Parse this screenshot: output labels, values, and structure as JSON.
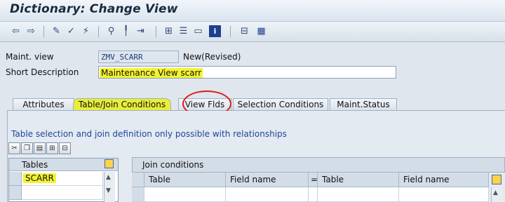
{
  "window": {
    "title": "Dictionary: Change View"
  },
  "toolbar": {
    "icons": [
      "back-icon",
      "forward-icon",
      "display-change-icon",
      "check-icon",
      "activate-icon",
      "where-used-icon",
      "object-list-icon",
      "navigate-icon",
      "hierarchy-icon",
      "print-icon",
      "display-icon",
      "info-icon",
      "technical-settings-icon",
      "grid-icon"
    ]
  },
  "form": {
    "maint_view_label": "Maint. view",
    "maint_view_value": "ZMV_SCARR",
    "status": "New(Revised)",
    "short_desc_label": "Short Description",
    "short_desc_value": "Maintenance View scarr"
  },
  "tabs": [
    {
      "label": "Attributes"
    },
    {
      "label": "Table/Join Conditions"
    },
    {
      "label": "View Flds"
    },
    {
      "label": "Selection Conditions"
    },
    {
      "label": "Maint.Status"
    }
  ],
  "panel": {
    "info": "Table selection and join definition only possible with relationships"
  },
  "tables_grid": {
    "header": "Tables",
    "rows": [
      "SCARR",
      "",
      ""
    ]
  },
  "join_grid": {
    "title": "Join conditions",
    "columns": [
      "Table",
      "Field name",
      "=",
      "Table",
      "Field name"
    ]
  },
  "colors": {
    "highlight": "#f3f332",
    "annotation": "#e0191a",
    "active_tab_highlight": "#f3f332"
  }
}
